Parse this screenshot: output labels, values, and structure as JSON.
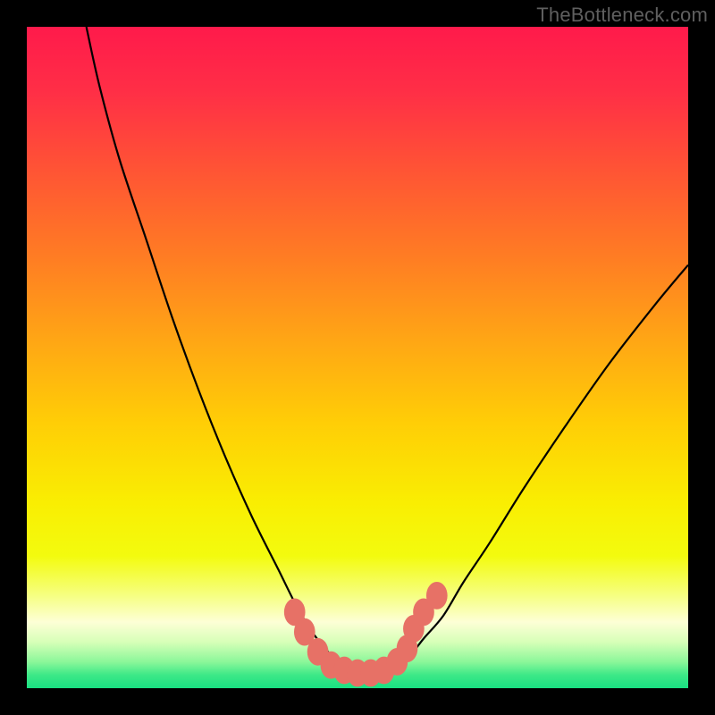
{
  "watermark": "TheBottleneck.com",
  "chart_data": {
    "type": "line",
    "title": "",
    "xlabel": "",
    "ylabel": "",
    "xlim": [
      0,
      100
    ],
    "ylim": [
      0,
      100
    ],
    "grid": false,
    "legend": false,
    "gradient_stops": [
      {
        "offset": 0.0,
        "color": "#ff1a4b"
      },
      {
        "offset": 0.1,
        "color": "#ff2f46"
      },
      {
        "offset": 0.22,
        "color": "#ff5534"
      },
      {
        "offset": 0.35,
        "color": "#ff7d23"
      },
      {
        "offset": 0.48,
        "color": "#ffa814"
      },
      {
        "offset": 0.6,
        "color": "#ffce06"
      },
      {
        "offset": 0.72,
        "color": "#f9ee02"
      },
      {
        "offset": 0.8,
        "color": "#f3fb0e"
      },
      {
        "offset": 0.86,
        "color": "#f6ff82"
      },
      {
        "offset": 0.9,
        "color": "#fdffd6"
      },
      {
        "offset": 0.93,
        "color": "#d7ffb8"
      },
      {
        "offset": 0.96,
        "color": "#8cf79a"
      },
      {
        "offset": 0.98,
        "color": "#3de887"
      },
      {
        "offset": 1.0,
        "color": "#19e082"
      }
    ],
    "series": [
      {
        "name": "bottleneck-curve",
        "x": [
          9.0,
          11.0,
          14.0,
          18.0,
          22.0,
          26.0,
          30.0,
          34.0,
          38.0,
          41.0,
          43.5,
          46.0,
          48.0,
          50.0,
          52.0,
          54.0,
          56.0,
          58.0,
          60.0,
          63.0,
          66.0,
          70.0,
          75.0,
          81.0,
          88.0,
          95.0,
          100.0
        ],
        "y": [
          100.0,
          91.0,
          80.0,
          68.0,
          56.0,
          45.0,
          35.0,
          26.0,
          18.0,
          12.0,
          8.0,
          5.0,
          3.2,
          2.5,
          2.5,
          2.7,
          3.5,
          5.0,
          7.5,
          11.0,
          16.0,
          22.0,
          30.0,
          39.0,
          49.0,
          58.0,
          64.0
        ]
      }
    ],
    "markers": {
      "name": "highlight-dots",
      "color": "#e77166",
      "x": [
        40.5,
        42.0,
        44.0,
        46.0,
        48.0,
        50.0,
        52.0,
        54.0,
        56.0,
        57.5,
        58.5,
        60.0,
        62.0
      ],
      "y": [
        11.5,
        8.5,
        5.5,
        3.5,
        2.7,
        2.3,
        2.3,
        2.7,
        4.0,
        6.0,
        9.0,
        11.5,
        14.0
      ],
      "r": 1.6
    }
  }
}
